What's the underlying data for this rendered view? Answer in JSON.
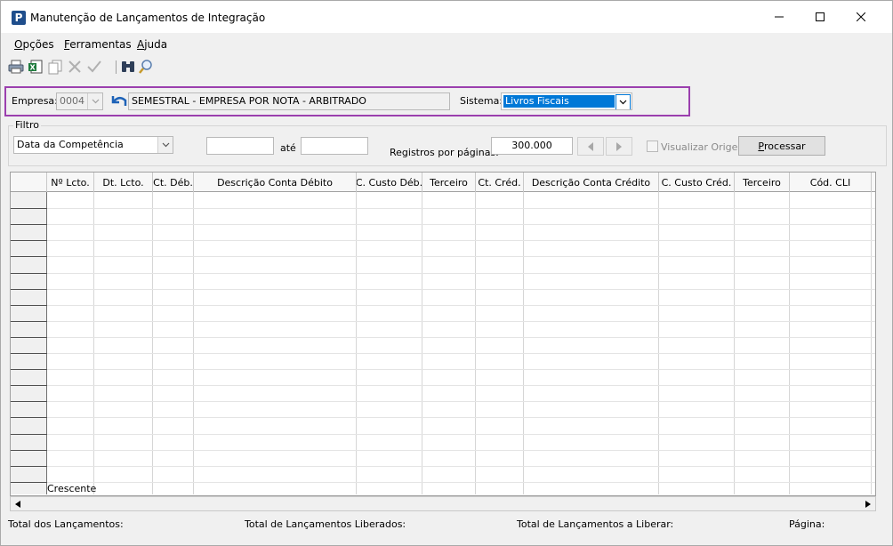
{
  "window": {
    "app_icon_letter": "P",
    "title": "Manutenção de Lançamentos de Integração"
  },
  "menu": {
    "items": [
      {
        "key": "O",
        "rest": "pções"
      },
      {
        "key": "F",
        "rest": "erramentas"
      },
      {
        "key": "A",
        "rest": "juda"
      }
    ]
  },
  "toolbar": {
    "icons": [
      "print-icon",
      "export-excel-icon",
      "copy-icon",
      "delete-icon",
      "confirm-icon",
      "binoculars-icon",
      "search-icon"
    ]
  },
  "empresa": {
    "label": "Empresa:",
    "code": "0004",
    "name": "SEMESTRAL - EMPRESA POR NOTA - ARBITRADO",
    "sistema_label": "Sistema:",
    "sistema_value": "Livros Fiscais",
    "highlight_color": "#9b3fae",
    "selection_color": "#0078d7"
  },
  "filtro": {
    "group_title": "Filtro",
    "type_value": "Data da Competência",
    "from_value": "",
    "ate_label": "até",
    "to_value": "",
    "registros_label": "Registros por páginas:",
    "registros_value": "300.000",
    "visualizar_label": "Visualizar Origem",
    "processar_key": "P",
    "processar_rest": "rocessar"
  },
  "grid": {
    "columns": [
      "Nº Lcto.",
      "Dt. Lcto.",
      "Ct. Déb.",
      "Descrição Conta Débito",
      "C. Custo Déb.",
      "Terceiro",
      "Ct. Créd.",
      "Descrição Conta Crédito",
      "C. Custo Créd.",
      "Terceiro",
      "Cód. CLI"
    ],
    "footer_text": "Crescente"
  },
  "status": {
    "total": "Total dos Lançamentos:",
    "liberados": "Total de Lançamentos Liberados:",
    "a_liberar": "Total de Lançamentos a Liberar:",
    "pagina": "Página:"
  }
}
